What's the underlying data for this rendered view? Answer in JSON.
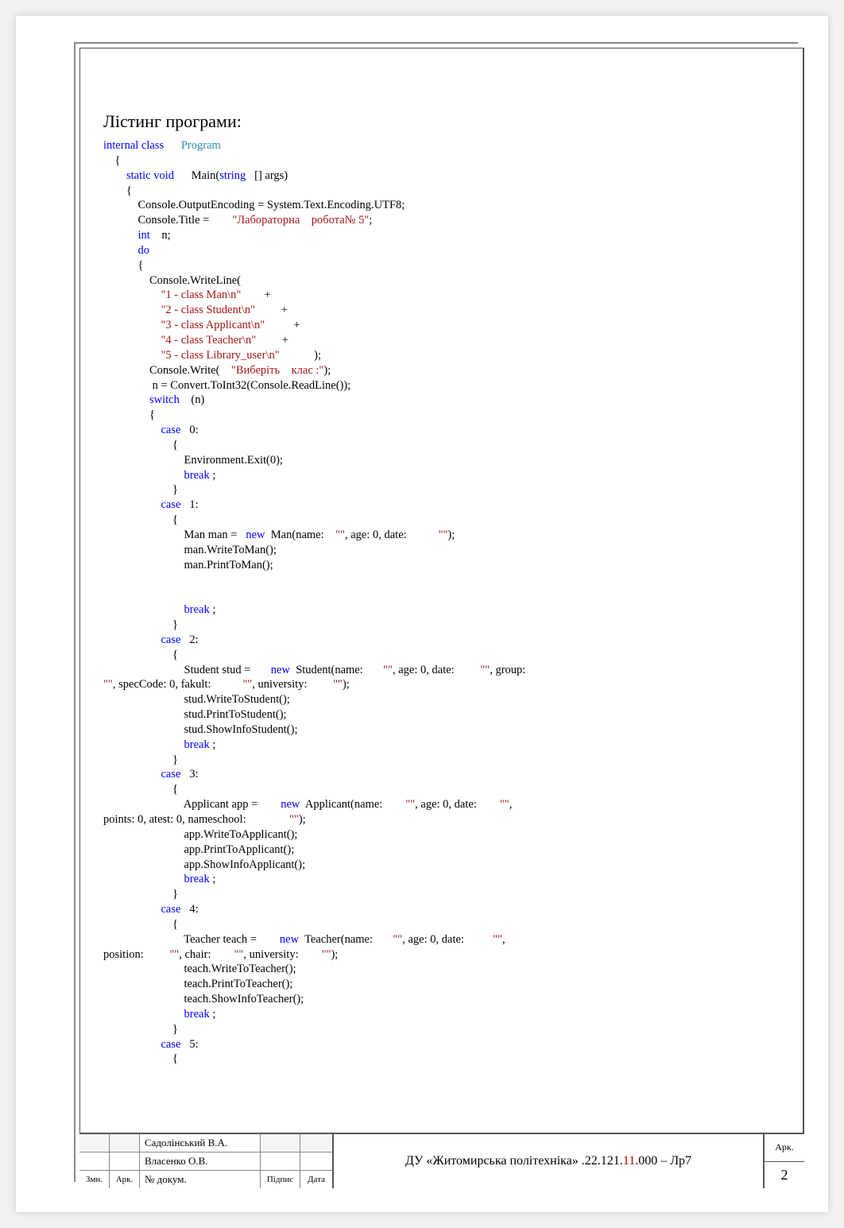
{
  "heading": "Лістинг програми:",
  "code": {
    "line1_kw1": "internal",
    "line1_kw2": "class",
    "line1_cls": "Program",
    "line3_kw1": "static",
    "line3_kw2": "void",
    "line3_main": " Main(",
    "line3_kw3": "string",
    "line3_rest": "[] args)",
    "line5": "            Console.OutputEncoding = System.Text.Encoding.UTF8;",
    "line6a": "            Console.Title = ",
    "line6_str1": "\"Лабораторна",
    "line6_str2": "робота№ 5\"",
    "line6b": ";",
    "line7_kw": "int",
    "line7_rest": " n;",
    "line8_kw": "do",
    "line10": "                Console.WriteLine(",
    "line11_str": "\"1 - class Man\\n\"",
    "line11_plus": " +",
    "line12_str": "\"2 - class Student\\n\"",
    "line12_plus": " +",
    "line13_str": "\"3 - class Applicant\\n\"",
    "line13_plus": " +",
    "line14_str": "\"4 - class Teacher\\n\"",
    "line14_plus": " +",
    "line15_str": "\"5 - class Library_user\\n\"",
    "line15_end": ");",
    "line16a": "                Console.Write(",
    "line16_str1": "\"Виберіть",
    "line16_str2": "клас :\"",
    "line16b": ");",
    "line17": "                 n = Convert.ToInt32(Console.ReadLine());",
    "line18_kw": "switch",
    "line18_rest": " (n)",
    "case_kw": "case",
    "case0": " 0:",
    "case1": " 1:",
    "case2": " 2:",
    "case3": " 3:",
    "case4": " 4:",
    "case5": " 5:",
    "env_exit": "                            Environment.Exit(0);",
    "break_kw": "break",
    "break_sc": ";",
    "man_a": "                            Man man = ",
    "new_kw": "new",
    "man_b": " Man(name: ",
    "empty_str": "\"\"",
    "man_c": ", age: 0, date: ",
    "man_d": ");",
    "man_w": "                            man.WriteToMan();",
    "man_p": "                            man.PrintToMan();",
    "stud_a": "                            Student stud = ",
    "stud_b": " Student(name: ",
    "stud_c": ", age: 0, date: ",
    "stud_d": ", group: ",
    "stud_e": ", specCode: 0, fakult: ",
    "stud_f": ", university: ",
    "stud_g": ");",
    "stud_w": "                            stud.WriteToStudent();",
    "stud_p": "                            stud.PrintToStudent();",
    "stud_s": "                            stud.ShowInfoStudent();",
    "app_a": "                            Applicant app = ",
    "app_b": " Applicant(name: ",
    "app_c": ", age: 0, date: ",
    "app_d": ", ",
    "app_e": "points: 0, atest: 0, nameschool: ",
    "app_f": ");",
    "app_w": "                            app.WriteToApplicant();",
    "app_p": "                            app.PrintToApplicant();",
    "app_s": "                            app.ShowInfoApplicant();",
    "teach_a": "                            Teacher teach = ",
    "teach_b": " Teacher(name: ",
    "teach_c": ", age: 0, date: ",
    "teach_d": ", ",
    "teach_e": "position: ",
    "teach_f": ", chair: ",
    "teach_g": ", university: ",
    "teach_h": ");",
    "teach_w": "                            teach.WriteToTeacher();",
    "teach_p": "                            teach.PrintToTeacher();",
    "teach_s": "                            teach.ShowInfoTeacher();"
  },
  "footer": {
    "row1_name": "Садолінський В.А.",
    "row2_name": "Власенко О.В.",
    "row3_c1": "Змн.",
    "row3_c2": "Арк.",
    "row3_name": "№ докум.",
    "row3_sign": "Підпис",
    "row3_date": "Дата",
    "mid_a": "ДУ «Житомирська політехніка»     .22.121.",
    "mid_red": "11",
    "mid_b": ".000 – Лр7",
    "right_top": "Арк.",
    "right_bot": "2"
  }
}
